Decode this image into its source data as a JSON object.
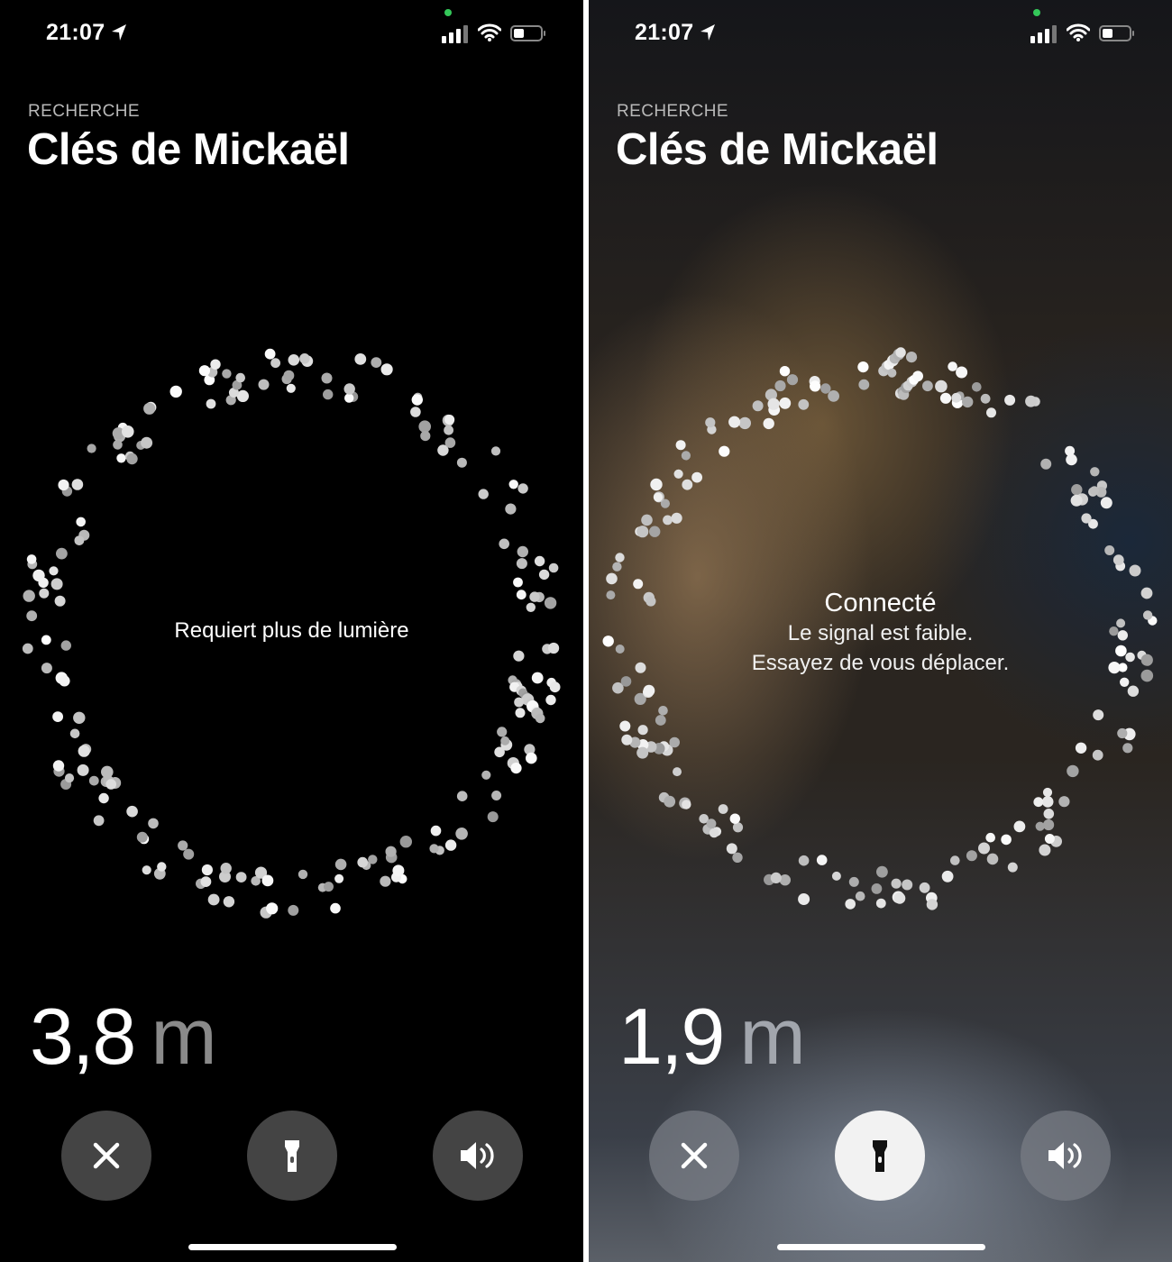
{
  "screens": [
    {
      "status_bar": {
        "time": "21:07"
      },
      "header": {
        "eyebrow": "RECHERCHE",
        "title": "Clés de Mickaël"
      },
      "message": {
        "text": "Requiert plus de lumière"
      },
      "distance": {
        "value": "3,8",
        "unit": "m"
      },
      "controls": {
        "close": "close-icon",
        "flashlight": "flashlight-icon",
        "sound": "speaker-icon",
        "flashlight_active": false
      }
    },
    {
      "status_bar": {
        "time": "21:07"
      },
      "header": {
        "eyebrow": "RECHERCHE",
        "title": "Clés de Mickaël"
      },
      "message": {
        "status": "Connecté",
        "line1": "Le signal est faible.",
        "line2": "Essayez de vous déplacer."
      },
      "distance": {
        "value": "1,9",
        "unit": "m"
      },
      "controls": {
        "close": "close-icon",
        "flashlight": "flashlight-icon",
        "sound": "speaker-icon",
        "flashlight_active": true
      }
    }
  ],
  "colors": {
    "status_green": "#34c759",
    "unit_gray": "#8a8a8a",
    "eyebrow_gray": "#b8b8b8"
  }
}
